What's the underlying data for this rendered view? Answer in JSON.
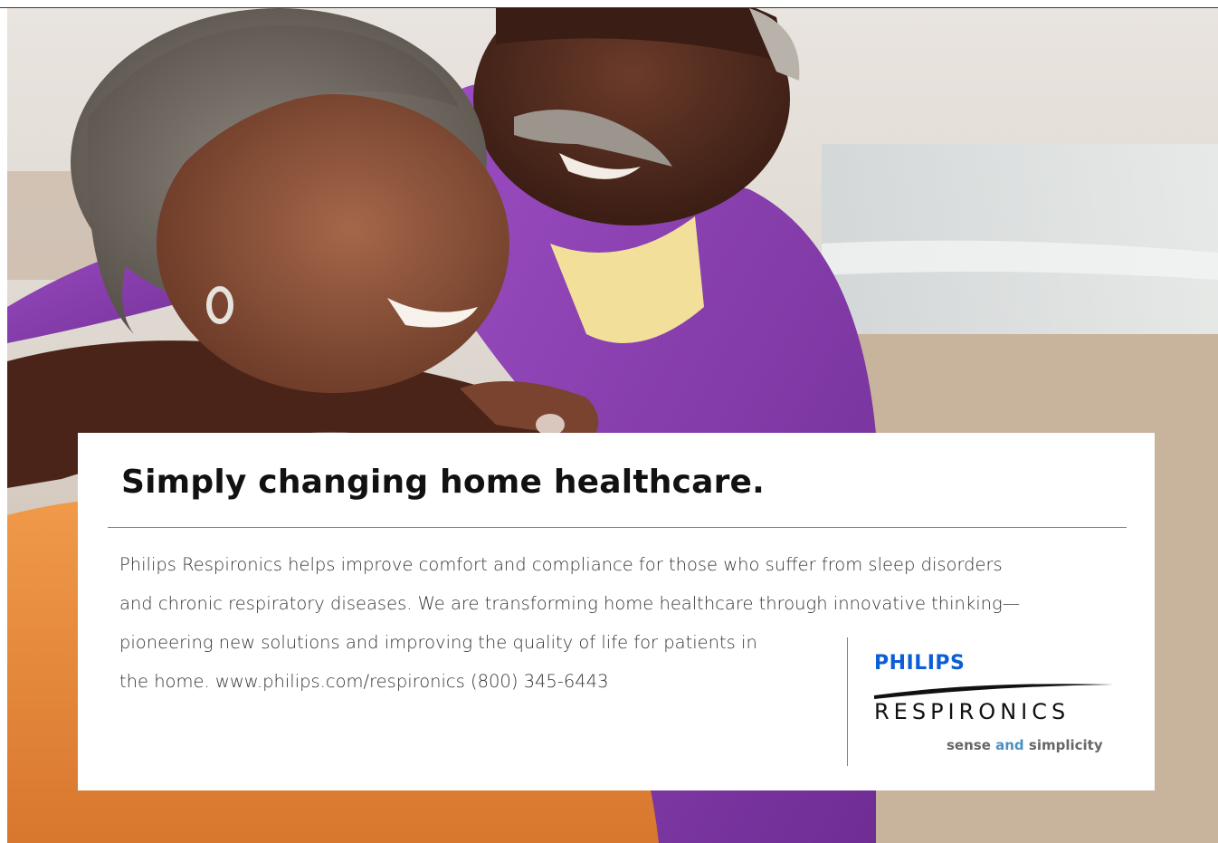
{
  "ad": {
    "headline": "Simply changing home healthcare.",
    "body_lines": [
      "Philips Respironics helps improve comfort and compliance for those who suffer from sleep disorders",
      "and chronic respiratory diseases. We are transforming home healthcare through innovative thinking—",
      "pioneering new solutions and improving the quality of life for patients in",
      "the home. www.philips.com/respironics  (800) 345-6443"
    ]
  },
  "logo": {
    "brand": "PHILIPS",
    "division": "RESPIRONICS",
    "tagline_part1": "sense",
    "tagline_part2": "and",
    "tagline_part3": "simplicity"
  },
  "colors": {
    "brand_blue": "#0b5ed7",
    "accent_blue": "#4a90c4",
    "shirt_purple": "#8a3fb0",
    "sweater_orange": "#e98a3e"
  }
}
